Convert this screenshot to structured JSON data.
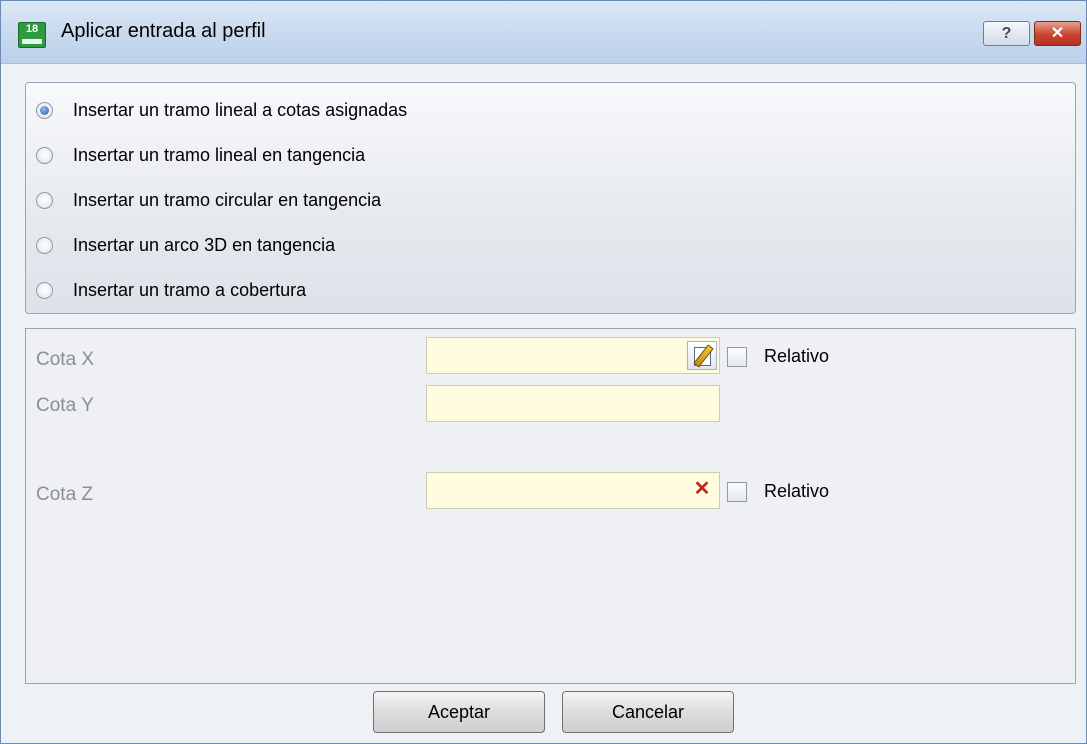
{
  "window": {
    "title": "Aplicar entrada al perfil",
    "app_icon_text": "18",
    "help_label": "?",
    "close_label": "✕"
  },
  "options": [
    {
      "label": "Insertar un tramo lineal a cotas asignadas",
      "selected": true
    },
    {
      "label": "Insertar un tramo lineal en tangencia",
      "selected": false
    },
    {
      "label": "Insertar un tramo circular en tangencia",
      "selected": false
    },
    {
      "label": "Insertar un arco 3D en tangencia",
      "selected": false
    },
    {
      "label": "Insertar un tramo a cobertura",
      "selected": false
    }
  ],
  "fields": {
    "x": {
      "label": "Cota X",
      "value": "",
      "icon": "edit-icon",
      "relative_label": "Relativo",
      "relative_checked": false
    },
    "y": {
      "label": "Cota Y",
      "value": ""
    },
    "z": {
      "label": "Cota Z",
      "value": "",
      "icon": "clear-icon",
      "relative_label": "Relativo",
      "relative_checked": false
    }
  },
  "buttons": {
    "ok": "Aceptar",
    "cancel": "Cancelar"
  },
  "colors": {
    "input_background": "#fefbdf",
    "disabled_label": "#8a8f96",
    "titlebar": "#c6d8ee",
    "close_button": "#c9452f"
  }
}
